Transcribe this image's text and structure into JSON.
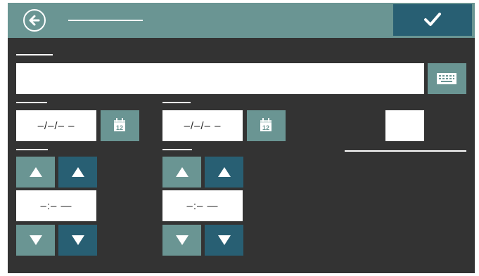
{
  "header": {
    "title": "",
    "back_icon": "back-arrow-circle-icon",
    "confirm_icon": "checkmark-icon"
  },
  "form": {
    "text_field_value": "",
    "keyboard_icon": "keyboard-icon",
    "start_date": "–/–/– –",
    "end_date": "–/–/– –",
    "calendar_icon": "calendar-12-icon",
    "start_time": "–:– —",
    "end_time": "–:– —"
  },
  "colors": {
    "background": "#333333",
    "teal_light": "#6a9593",
    "teal_dark": "#285f73",
    "field": "#ffffff"
  }
}
